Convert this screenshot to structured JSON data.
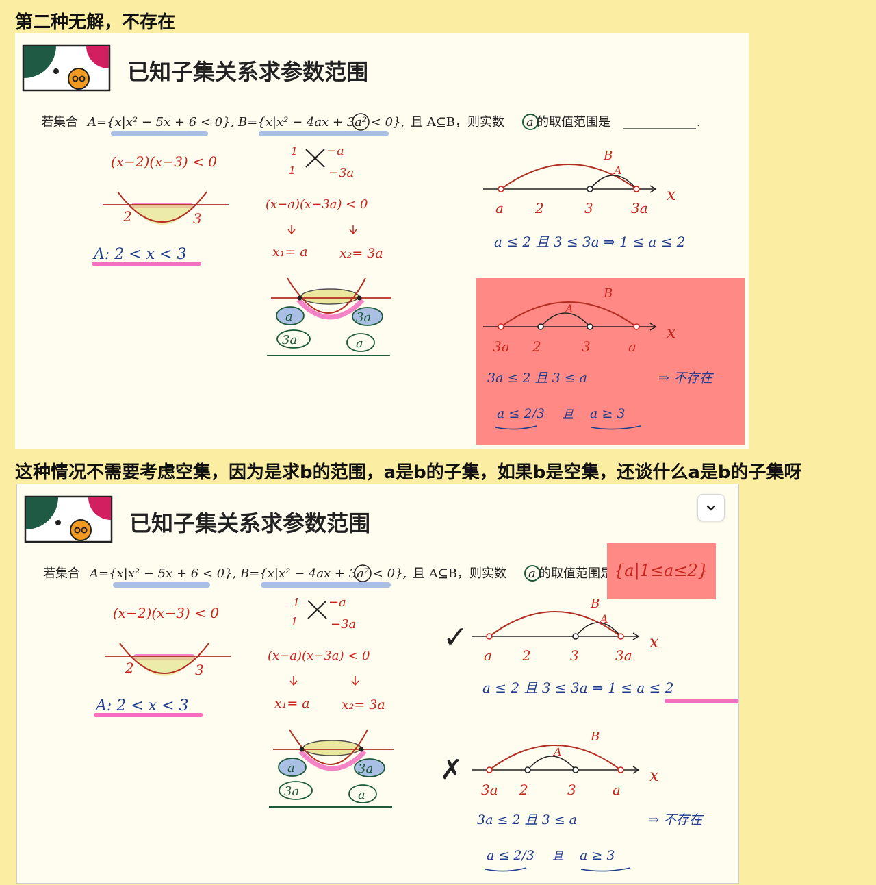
{
  "headings": {
    "top": "第二种无解，不存在",
    "middle": "这种情况不需要考虑空集，因为是求b的范围，a是b的子集，如果b是空集，还谈什么a是b的子集呀"
  },
  "slide": {
    "title": "已知子集关系求参数范围",
    "question": {
      "prefix": "若集合",
      "set_a": "A={x|x² − 5x + 6 < 0},",
      "set_b": "B={x|x² − 4ax + 3a² < 0},",
      "condition": "且 A⊆B，则实数",
      "var": "a",
      "suffix": "的取值范围是",
      "blank_end": "."
    },
    "left": {
      "factored": "(x−2)(x−3) < 0",
      "root_left": "2",
      "root_right": "3",
      "result": "A:  2 < x < 3"
    },
    "middle": {
      "cross_top": "−a",
      "cross_bottom": "−3a",
      "cross_left_top": "1",
      "cross_left_bottom": "1",
      "factored": "(x−a)(x−3a) < 0",
      "root1": "x₁= a",
      "root2": "x₂= 3a",
      "circle_a": "a",
      "circle_3a": "3a"
    },
    "case1": {
      "label_b": "B",
      "label_a": "A",
      "axis": "x",
      "ticks": [
        "a",
        "2",
        "3",
        "3a"
      ],
      "condition": "a ≤ 2  且  3 ≤ 3a  ⇒  1 ≤ a ≤ 2",
      "result": "1 ≤ a ≤ 2"
    },
    "case2": {
      "label_b": "B",
      "label_a": "A",
      "axis": "x",
      "ticks": [
        "3a",
        "2",
        "3",
        "a"
      ],
      "condition": "3a ≤ 2  且  3 ≤ a",
      "result": "⇒ 不存在",
      "sub_left": "a ≤ 2/3",
      "sub_mid": "且",
      "sub_right": "a ≥ 3"
    },
    "answer": "{a|1≤a≤2}",
    "marks": {
      "check": "✓",
      "cross": "✗"
    }
  },
  "colors": {
    "background": "#fbeea3",
    "panel": "#fffdf0",
    "red_highlight": "#ff8a85",
    "ink_red": "#c8251c",
    "ink_blue": "#1f3d8c",
    "pink": "#f36fbf",
    "blue_highlight": "#a9bfe3"
  },
  "icons": {
    "expand": "chevron-down-icon"
  }
}
